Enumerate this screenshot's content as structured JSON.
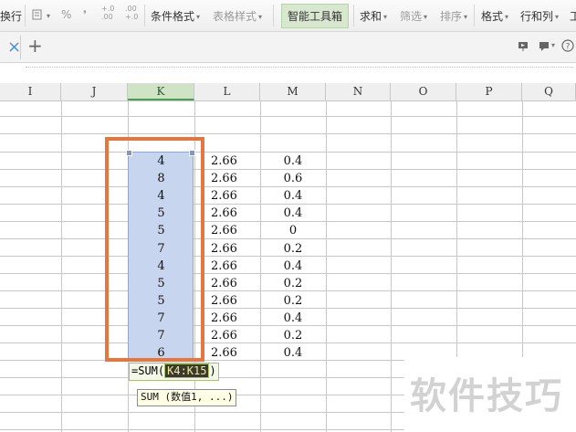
{
  "toolbar": {
    "wrap_text": "换行",
    "percent": "%",
    "thousands": "❜",
    "inc_decimal": "+.0\n.00",
    "dec_decimal": ".00\n+.0",
    "conditional_format": "条件格式",
    "table_style": "表格样式",
    "smart_toolbox": "智能工具箱",
    "sum": "求和",
    "filter": "筛选",
    "sort": "排序",
    "format": "格式",
    "row_col": "行和列",
    "more": "工"
  },
  "tabs": {
    "close": "×",
    "add": "+"
  },
  "columns": [
    "I",
    "J",
    "K",
    "L",
    "M",
    "N",
    "O",
    "P",
    "Q"
  ],
  "active_column": "K",
  "rows": [
    {
      "k": "4",
      "l": "2.66",
      "m": "0.4"
    },
    {
      "k": "8",
      "l": "2.66",
      "m": "0.6"
    },
    {
      "k": "4",
      "l": "2.66",
      "m": "0.4"
    },
    {
      "k": "5",
      "l": "2.66",
      "m": "0.4"
    },
    {
      "k": "5",
      "l": "2.66",
      "m": "0"
    },
    {
      "k": "7",
      "l": "2.66",
      "m": "0.2"
    },
    {
      "k": "4",
      "l": "2.66",
      "m": "0.4"
    },
    {
      "k": "5",
      "l": "2.66",
      "m": "0.2"
    },
    {
      "k": "5",
      "l": "2.66",
      "m": "0.2"
    },
    {
      "k": "7",
      "l": "2.66",
      "m": "0.4"
    },
    {
      "k": "7",
      "l": "2.66",
      "m": "0.2"
    },
    {
      "k": "6",
      "l": "2.66",
      "m": "0.4"
    }
  ],
  "formula": {
    "prefix": "=SUM(",
    "range": "K4:K15",
    "suffix": ")"
  },
  "tooltip": "SUM (数值1, ...)",
  "watermark": "软件技巧",
  "colors": {
    "selection": "#c7d5ef",
    "highlight_frame": "#e4773f",
    "active_header": "#cfe3c6",
    "smart_toolbox_bg": "#d8e8cf"
  }
}
